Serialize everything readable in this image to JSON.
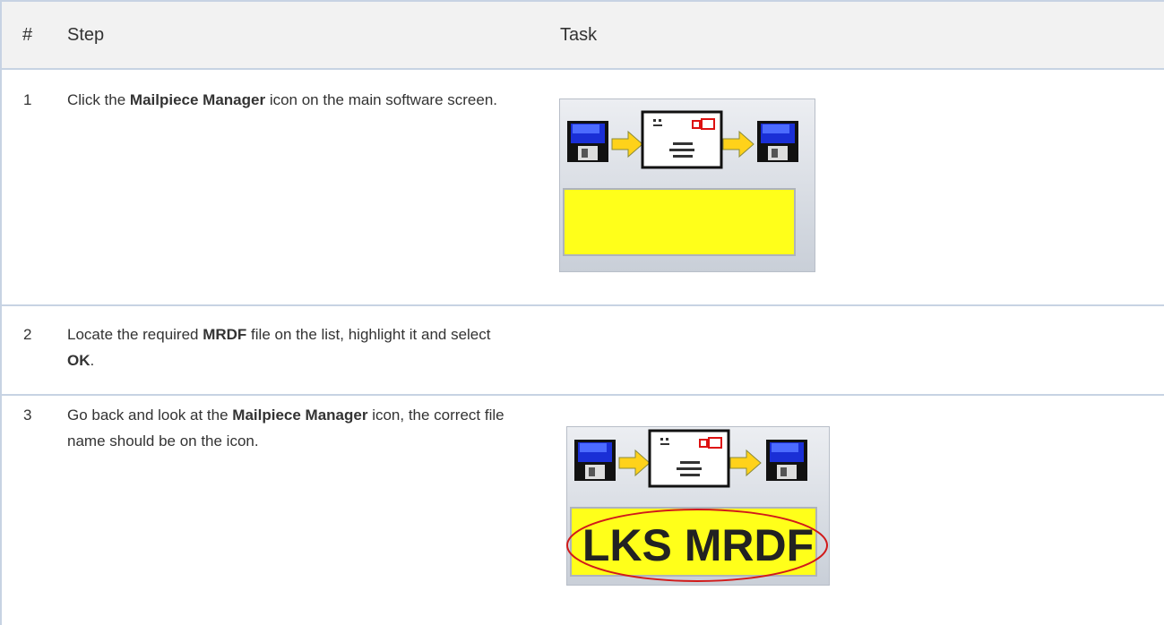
{
  "table": {
    "headers": [
      "#",
      "Step",
      "Task"
    ],
    "rows": [
      {
        "num": "1",
        "parts": [
          {
            "t": "Click the "
          },
          {
            "b": "Mailpiece Manager"
          },
          {
            "t": " icon on the main software screen."
          }
        ]
      },
      {
        "num": "2",
        "parts": [
          {
            "t": "Locate the required "
          },
          {
            "b": "MRDF"
          },
          {
            "t": " file on the list, highlight it and select "
          },
          {
            "b": "OK"
          },
          {
            "t": "."
          }
        ]
      },
      {
        "num": "3",
        "parts": [
          {
            "t": "Go back and look at the "
          },
          {
            "b": "Mailpiece Manager"
          },
          {
            "t": " icon, the correct file name should be on the icon."
          }
        ]
      }
    ]
  },
  "icon_after": {
    "file_name": "LKS MRDF"
  },
  "colors": {
    "border": "#c7d3e3",
    "header_bg": "#f2f2f2",
    "label_yellow": "#ffff1a",
    "highlight_circle": "#d11a1a",
    "disk_blue": "#1a2fd6",
    "arrow_yellow": "#ffd21a"
  }
}
